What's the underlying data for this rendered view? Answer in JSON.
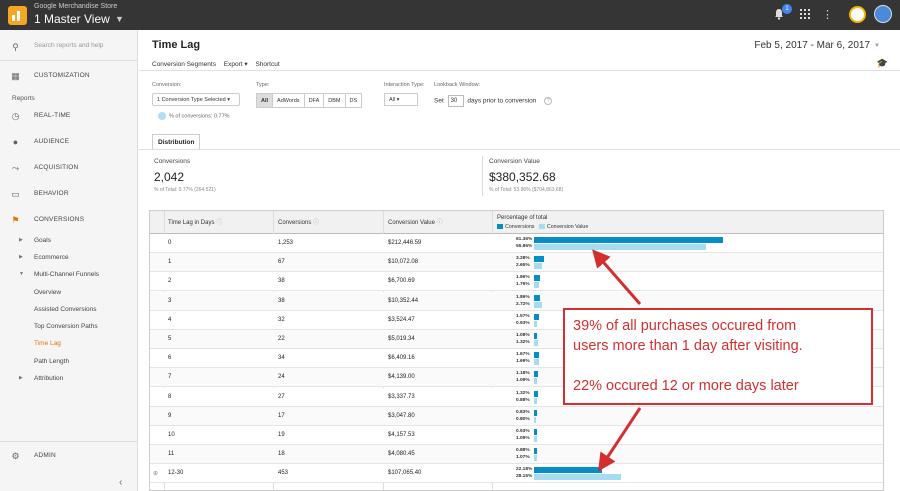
{
  "header": {
    "store_name": "Google Merchandise Store",
    "view_name": "1 Master View",
    "notification_count": "1",
    "icons": [
      "ga-logo-icon",
      "caret-down-icon",
      "bell-icon",
      "apps-grid-icon",
      "kebab-menu-icon",
      "ga-circle-icon",
      "avatar-icon"
    ]
  },
  "sidebar": {
    "search_placeholder": "Search reports and help",
    "customization": "CUSTOMIZATION",
    "reports_heading": "Reports",
    "sections": [
      {
        "label": "REAL-TIME",
        "icon": "clock-icon"
      },
      {
        "label": "AUDIENCE",
        "icon": "person-icon"
      },
      {
        "label": "ACQUISITION",
        "icon": "acquisition-icon"
      },
      {
        "label": "BEHAVIOR",
        "icon": "behavior-icon"
      },
      {
        "label": "CONVERSIONS",
        "icon": "flag-icon"
      }
    ],
    "sub_items": [
      {
        "label": "Goals"
      },
      {
        "label": "Ecommerce"
      },
      {
        "label": "Multi-Channel Funnels"
      },
      {
        "label": "Overview"
      },
      {
        "label": "Assisted Conversions"
      },
      {
        "label": "Top Conversion Paths"
      },
      {
        "label": "Time Lag"
      },
      {
        "label": "Path Length"
      },
      {
        "label": "Attribution"
      }
    ],
    "admin": "ADMIN",
    "accent_color": "#e37400"
  },
  "page": {
    "title": "Time Lag",
    "date_range": "Feb 5, 2017 - Mar 6, 2017",
    "toolbar": [
      "Conversion Segments",
      "Export ▾",
      "Shortcut"
    ]
  },
  "filters": {
    "conversion_label": "Conversion:",
    "conversion_value": "1 Conversion Type Selected",
    "pct_conversions": "% of conversions: 0.77%",
    "type_label": "Type:",
    "types": [
      "All",
      "AdWords",
      "DFA",
      "DBM",
      "DS"
    ],
    "interaction_label": "Interaction Type:",
    "interaction_value": "All",
    "lookback_label": "Lookback Window:",
    "lookback_prefix": "Set",
    "lookback_days": "30",
    "lookback_suffix": "days prior to conversion",
    "help": "?"
  },
  "tabs": {
    "distribution": "Distribution"
  },
  "scorecards": {
    "conversions_label": "Conversions",
    "conversions_value": "2,042",
    "conversions_sub": "% of Total: 0.77% (264,521)",
    "value_label": "Conversion Value",
    "value_value": "$380,352.68",
    "value_sub": "% of Total: 53.96% ($704,863.68)"
  },
  "table": {
    "headers": [
      "Time Lag in Days",
      "Conversions",
      "Conversion Value",
      "Percentage of total"
    ],
    "legend": [
      "Conversions",
      "Conversion Value"
    ],
    "colors": {
      "conversions": "#058dc7",
      "value": "#a6dcf2"
    },
    "rows": [
      {
        "days": "0",
        "conversions": "1,253",
        "value": "$212,446.59",
        "pct_conv": "61.36%",
        "pct_val": "55.86%"
      },
      {
        "days": "1",
        "conversions": "67",
        "value": "$10,072.08",
        "pct_conv": "3.28%",
        "pct_val": "2.65%"
      },
      {
        "days": "2",
        "conversions": "38",
        "value": "$6,700.69",
        "pct_conv": "1.86%",
        "pct_val": "1.76%"
      },
      {
        "days": "3",
        "conversions": "38",
        "value": "$10,352.44",
        "pct_conv": "1.86%",
        "pct_val": "2.72%"
      },
      {
        "days": "4",
        "conversions": "32",
        "value": "$3,524.47",
        "pct_conv": "1.57%",
        "pct_val": "0.93%"
      },
      {
        "days": "5",
        "conversions": "22",
        "value": "$5,019.34",
        "pct_conv": "1.08%",
        "pct_val": "1.32%"
      },
      {
        "days": "6",
        "conversions": "34",
        "value": "$6,409.16",
        "pct_conv": "1.67%",
        "pct_val": "1.69%"
      },
      {
        "days": "7",
        "conversions": "24",
        "value": "$4,139.00",
        "pct_conv": "1.18%",
        "pct_val": "1.09%"
      },
      {
        "days": "8",
        "conversions": "27",
        "value": "$3,337.73",
        "pct_conv": "1.32%",
        "pct_val": "0.88%"
      },
      {
        "days": "9",
        "conversions": "17",
        "value": "$3,047.80",
        "pct_conv": "0.83%",
        "pct_val": "0.80%"
      },
      {
        "days": "10",
        "conversions": "19",
        "value": "$4,157.53",
        "pct_conv": "0.93%",
        "pct_val": "1.09%"
      },
      {
        "days": "11",
        "conversions": "18",
        "value": "$4,080.45",
        "pct_conv": "0.88%",
        "pct_val": "1.07%"
      },
      {
        "days": "12-30",
        "conversions": "453",
        "value": "$107,065.40",
        "pct_conv": "22.18%",
        "pct_val": "28.15%",
        "expandable": true
      }
    ]
  },
  "annotation": {
    "line1": "39% of all purchases occured from",
    "line2": "users more than 1 day after visiting.",
    "line3": "22% occured 12 or more days later",
    "color": "#d32f2f"
  }
}
